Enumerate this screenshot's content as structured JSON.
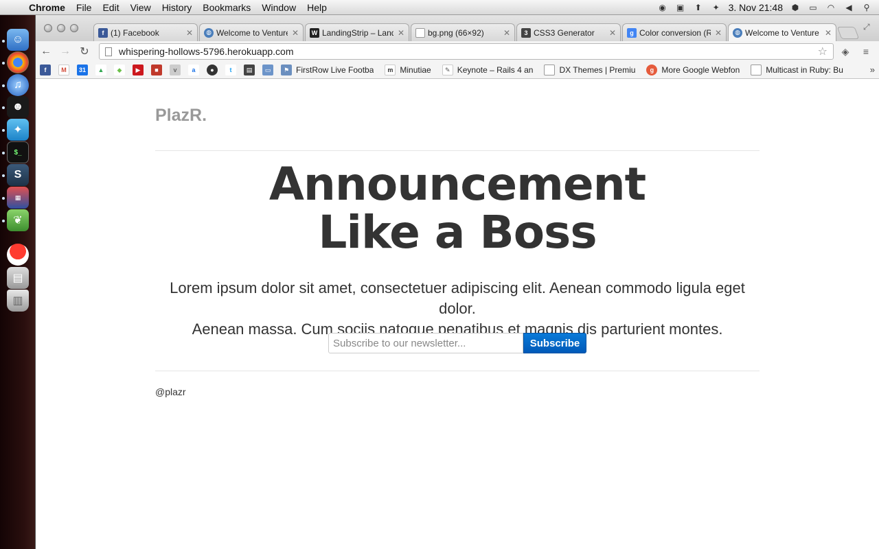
{
  "menubar": {
    "app": "Chrome",
    "items": [
      "File",
      "Edit",
      "View",
      "History",
      "Bookmarks",
      "Window",
      "Help"
    ],
    "clock": "3. Nov  21:48"
  },
  "tabs": [
    {
      "label": "(1) Facebook",
      "favicon": "facebook-icon",
      "color": "#3b5998"
    },
    {
      "label": "Welcome to Venture",
      "favicon": "globe-icon",
      "color": "#4a7ebb"
    },
    {
      "label": "LandingStrip – Land",
      "favicon": "w-icon",
      "color": "#222222"
    },
    {
      "label": "bg.png (66×92)",
      "favicon": "page-icon",
      "color": "#999999"
    },
    {
      "label": "CSS3 Generator",
      "favicon": "css3-icon",
      "color": "#444444"
    },
    {
      "label": "Color conversion (R",
      "favicon": "google-icon",
      "color": "#4285f4"
    },
    {
      "label": "Welcome to Venture",
      "favicon": "globe-icon",
      "color": "#4a7ebb",
      "active": true
    }
  ],
  "address": {
    "url": "whispering-hollows-5796.herokuapp.com"
  },
  "bookmarks": {
    "icon_only": [
      {
        "name": "facebook-icon",
        "color": "#3b5998",
        "glyph": "f"
      },
      {
        "name": "gmail-icon",
        "color": "#d14836",
        "glyph": "M"
      },
      {
        "name": "calendar-icon",
        "color": "#1a73e8",
        "glyph": "31"
      },
      {
        "name": "drive-icon",
        "color": "#34a853",
        "glyph": "▲"
      },
      {
        "name": "feedly-icon",
        "color": "#6cc04a",
        "glyph": "◆"
      },
      {
        "name": "youtube-icon",
        "color": "#cc181e",
        "glyph": "▶"
      },
      {
        "name": "stamp-icon",
        "color": "#c0392b",
        "glyph": "■"
      },
      {
        "name": "vcd-icon",
        "color": "#999999",
        "glyph": "v"
      },
      {
        "name": "amazon-icon",
        "color": "#1a73e8",
        "glyph": "a"
      },
      {
        "name": "github-icon",
        "color": "#333333",
        "glyph": "●"
      },
      {
        "name": "twitter-icon",
        "color": "#1da1f2",
        "glyph": "t"
      },
      {
        "name": "printer-icon",
        "color": "#444444",
        "glyph": "▤"
      },
      {
        "name": "folder-icon",
        "color": "#6c94c9",
        "glyph": "▭"
      }
    ],
    "labeled": [
      {
        "label": "FirstRow Live Footba",
        "icon": "firstrow-icon",
        "color": "#6b8fbf"
      },
      {
        "label": "Minutiae",
        "icon": "minutiae-icon",
        "color": "#333333"
      },
      {
        "label": "Keynote – Rails 4 an",
        "icon": "keynote-icon",
        "color": "#888888"
      },
      {
        "label": "DX Themes | Premiu",
        "icon": "page-icon",
        "color": "#999999"
      },
      {
        "label": "More Google Webfon",
        "icon": "google-fonts-icon",
        "color": "#e55b3c"
      },
      {
        "label": "Multicast in Ruby: Bu",
        "icon": "page-icon",
        "color": "#999999"
      }
    ]
  },
  "page": {
    "brand": "PlazR.",
    "headline_line1": "Announcement",
    "headline_line2": "Like a Boss",
    "lead_line1": "Lorem ipsum dolor sit amet, consectetuer adipiscing elit. Aenean commodo ligula eget dolor.",
    "lead_line2": "Aenean massa. Cum sociis natoque penatibus et magnis dis parturient montes.",
    "newsletter_placeholder": "Subscribe to our newsletter...",
    "subscribe_label": "Subscribe",
    "footer_handle": "@plazr"
  }
}
